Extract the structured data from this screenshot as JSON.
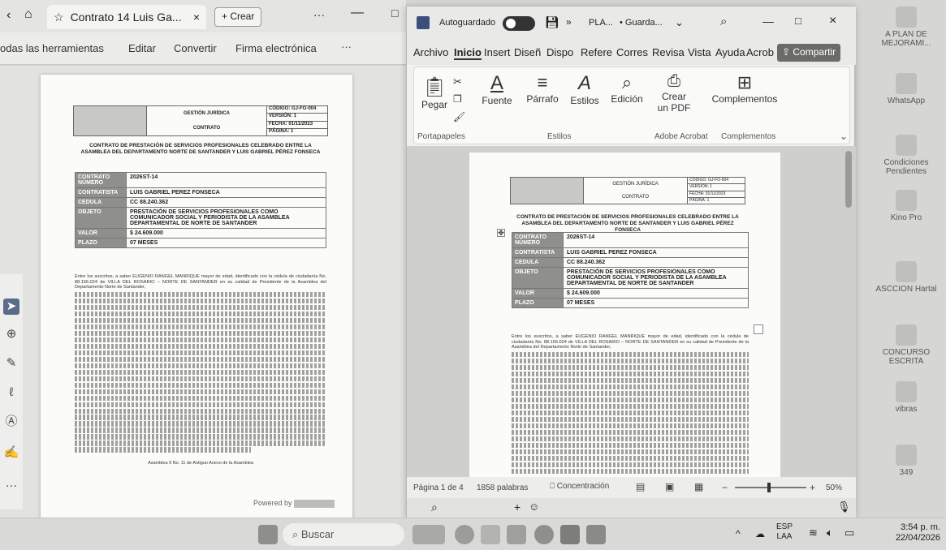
{
  "browser": {
    "tab_title": "Contrato 14 Luis Ga...",
    "new_tab_label": "Crear",
    "more_label": "···",
    "toolbar": [
      "odas las herramientas",
      "Editar",
      "Convertir",
      "Firma electrónica",
      "···"
    ]
  },
  "document": {
    "header_center_top": "GESTIÓN JURÍDICA",
    "header_center_bottom": "CONTRATO",
    "header_right": [
      "CÓDIGO: GJ-FO-004",
      "VERSIÓN: 1",
      "FECHA: 01/11/2023",
      "PÁGINA: 1"
    ],
    "title": "CONTRATO DE PRESTACIÓN DE SERVICIOS PROFESIONALES CELEBRADO ENTRE LA ASAMBLEA DEL DEPARTAMENTO NORTE DE SANTANDER Y LUIS GABRIEL PÉREZ FONSECA",
    "fields": [
      {
        "key": "CONTRATO NÚMERO",
        "value": "2026ST-14"
      },
      {
        "key": "CONTRATISTA",
        "value": "LUIS GABRIEL PEREZ FONSECA"
      },
      {
        "key": "CEDULA",
        "value": "CC 88.240.362"
      },
      {
        "key": "OBJETO",
        "value": "PRESTACIÓN DE SERVICIOS PROFESIONALES COMO COMUNICADOR SOCIAL Y PERIODISTA DE LA ASAMBLEA DEPARTAMENTAL DE NORTE DE SANTANDER"
      },
      {
        "key": "VALOR",
        "value": "$ 24.609.000"
      },
      {
        "key": "PLAZO",
        "value": "07 MESES"
      }
    ],
    "body_intro": "Entre los suscritos, a saber EUGENIO RANGEL MANRIQUE mayor de edad, identificado con la cédula de ciudadanía No. 88.156.024 de VILLA DEL ROSARIO – NORTE DE SANTANDER en su calidad de Presidente de la Asamblea del Departamento Norte de Santander,",
    "footer": "Asamblea 9 No. 11 de Antiguo Anexo de la Asamblea",
    "powered_by": "Powered by"
  },
  "word": {
    "autosave": "Autoguardado",
    "file_title": "PLA...",
    "saved_status": "• Guarda...",
    "menu": [
      "Archivo",
      "Inicio",
      "Insert",
      "Diseñ",
      "Dispo",
      "Refere",
      "Corres",
      "Revisa",
      "Vista",
      "Ayuda",
      "Acrob"
    ],
    "share": "Compartir",
    "ribbon": {
      "paste": "Pegar",
      "font": "Fuente",
      "paragraph": "Párrafo",
      "styles": "Estilos",
      "edit": "Edición",
      "create_pdf_1": "Crear",
      "create_pdf_2": "un PDF",
      "addins": "Complementos",
      "group_clipboard": "Portapapeles",
      "group_styles": "Estilos",
      "group_acrobat": "Adobe Acrobat",
      "group_addins": "Complementos"
    },
    "status": {
      "page": "Página 1 de 4",
      "words": "1858 palabras",
      "focus": "Concentración",
      "zoom": "50%"
    }
  },
  "desktop_icons": [
    {
      "label": "A PLAN DE MEJORAMI..."
    },
    {
      "label": "WhatsApp"
    },
    {
      "label": "Condiciones Pendientes"
    },
    {
      "label": "Kino Pro"
    },
    {
      "label": "ASCCION Hartal"
    },
    {
      "label": "CONCURSO ESCRITA"
    },
    {
      "label": "vibras"
    },
    {
      "label": "349"
    }
  ],
  "taskbar": {
    "search": "Buscar",
    "lang_1": "ESP",
    "lang_2": "LAA",
    "time": "3:54 p. m.",
    "date": "22/04/2026"
  }
}
